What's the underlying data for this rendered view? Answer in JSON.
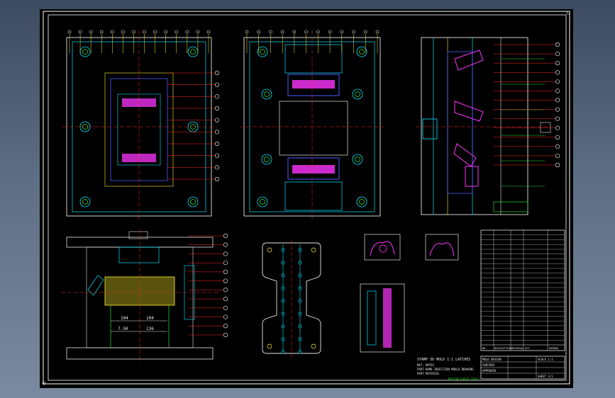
{
  "drawing": {
    "dims": {
      "a": "104",
      "b": "104",
      "c": "7.50",
      "d": "136"
    },
    "note_lines": [
      "STAMP 3D MOLD 1:1 LATCHES",
      "MAT. NOTES",
      "PART NAME    INJECTION MOULD DRAWING",
      "PART MATERIAL",
      "DESIGN  CHECK  SCALE"
    ],
    "bom_header": [
      "NO.",
      "DESCRIPTION",
      "MATERIAL",
      "QTY",
      "REMARK"
    ],
    "bom_row_count": 24,
    "title_block": [
      "MOLD DESIGN",
      "CHECKED",
      "APPROVED",
      "SCALE 1:1",
      "SHEET 1/1"
    ]
  },
  "colors": {
    "background": "#000000",
    "frame": "#ffffff",
    "outline": "#e6e6e6",
    "cyan": "#00e5ff",
    "yellow": "#ffef2a",
    "red": "#ff2b2b",
    "magenta": "#ff35ff",
    "blue": "#4a5cff",
    "green": "#2ee02e"
  }
}
